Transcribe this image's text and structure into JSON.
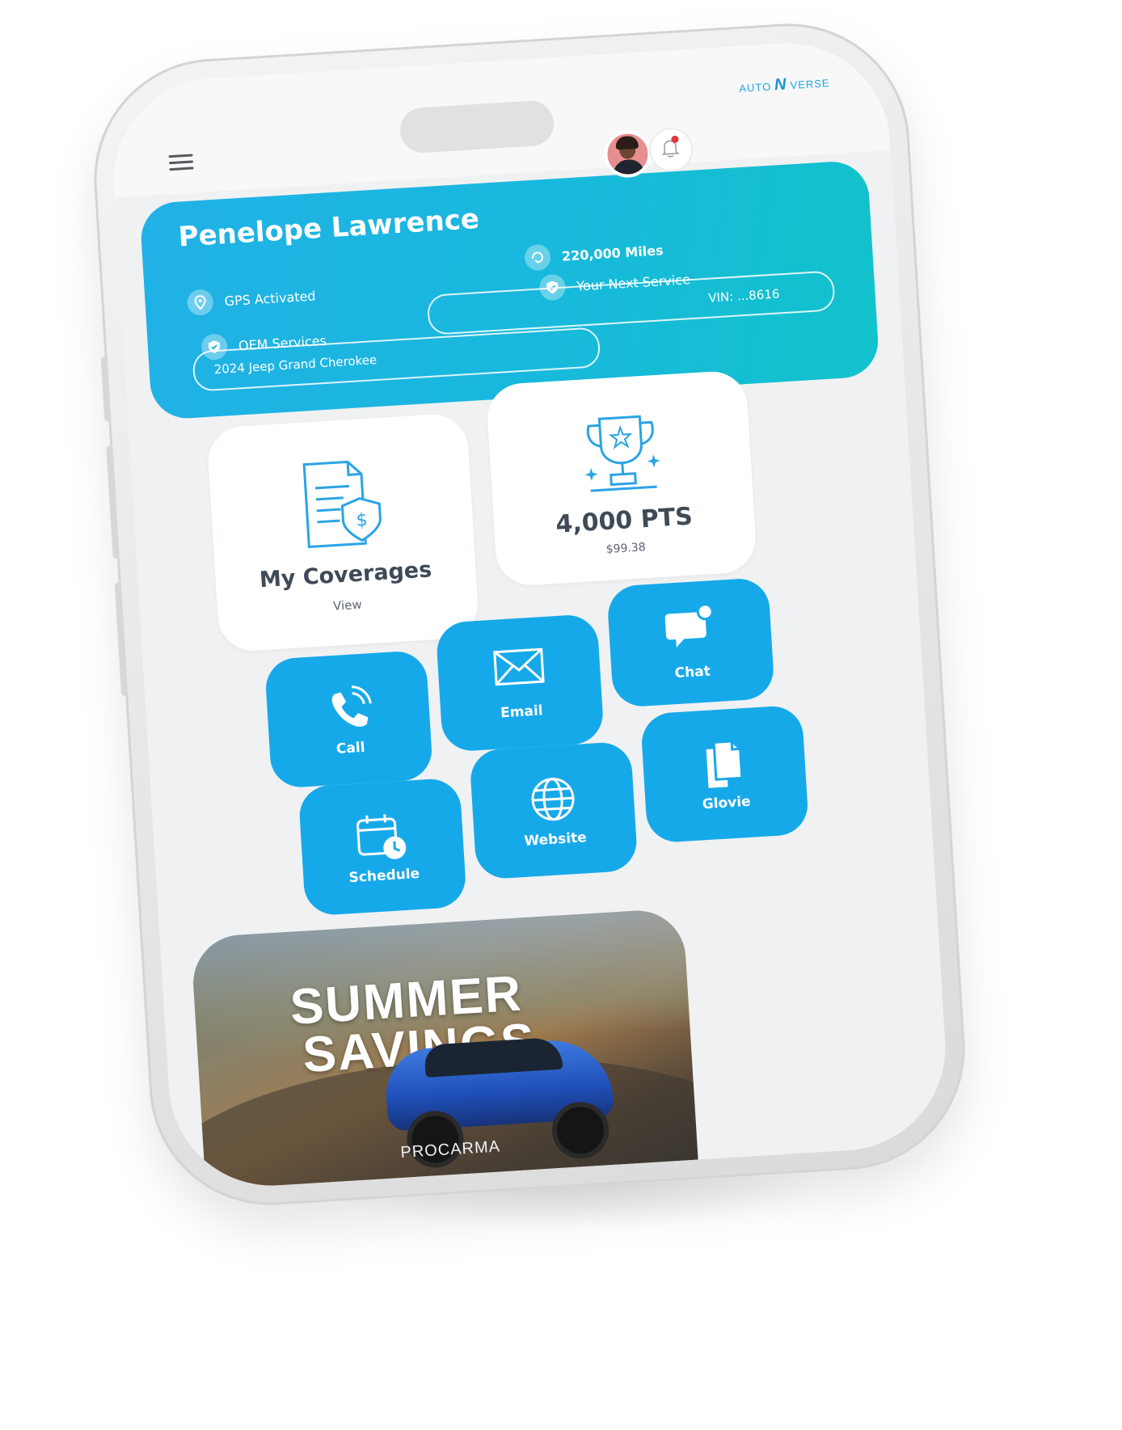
{
  "header": {
    "logo_left": "AUTO",
    "logo_mark": "N",
    "logo_right": "VERSE",
    "menu_icon": "hamburger-menu-icon",
    "notification_icon": "bell-icon"
  },
  "profile": {
    "name": "Penelope Lawrence",
    "miles": "220,000 Miles",
    "gps": "GPS Activated",
    "next_service": "Your Next Service",
    "oem": "OEM Services",
    "vin": "VIN: ...8616",
    "vehicle": "2024 Jeep Grand Cherokee"
  },
  "tiles": {
    "coverages_title": "My Coverages",
    "coverages_action": "View",
    "points": "4,000 PTS",
    "points_value": "$99.38"
  },
  "actions": [
    {
      "label": "Call",
      "icon": "phone-icon"
    },
    {
      "label": "Email",
      "icon": "envelope-icon"
    },
    {
      "label": "Chat",
      "icon": "chat-bubble-icon"
    },
    {
      "label": "Schedule",
      "icon": "calendar-clock-icon"
    },
    {
      "label": "Website",
      "icon": "globe-icon"
    },
    {
      "label": "Glovie",
      "icon": "documents-icon"
    }
  ],
  "banner": {
    "line1": "SUMMER",
    "line2": "SAVINGS",
    "brand": "PROCARMA"
  },
  "colors": {
    "accent": "#16a9ea",
    "card_gradient_start": "#21b1e6",
    "card_gradient_end": "#12c2cb",
    "text_dark": "#3f4a56"
  }
}
